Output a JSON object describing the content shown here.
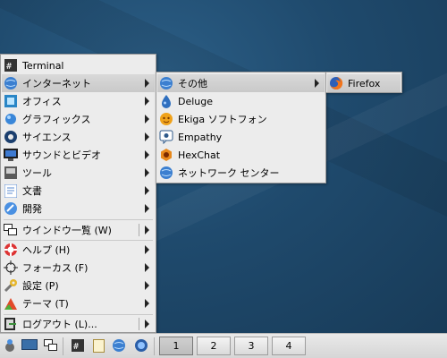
{
  "main_menu": {
    "items": [
      {
        "label": "Terminal"
      },
      {
        "label": "インターネット"
      },
      {
        "label": "オフィス"
      },
      {
        "label": "グラフィックス"
      },
      {
        "label": "サイエンス"
      },
      {
        "label": "サウンドとビデオ"
      },
      {
        "label": "ツール"
      },
      {
        "label": "文書"
      },
      {
        "label": "開発"
      },
      {
        "label": "ウインドウ一覧 (W)"
      },
      {
        "label": "ヘルプ (H)"
      },
      {
        "label": "フォーカス (F)"
      },
      {
        "label": "設定 (P)"
      },
      {
        "label": "テーマ (T)"
      },
      {
        "label": "ログアウト (L)..."
      }
    ]
  },
  "internet_menu": {
    "items": [
      {
        "label": "その他"
      },
      {
        "label": "Deluge"
      },
      {
        "label": "Ekiga ソフトフォン"
      },
      {
        "label": "Empathy"
      },
      {
        "label": "HexChat"
      },
      {
        "label": "ネットワーク センター"
      }
    ]
  },
  "other_menu": {
    "items": [
      {
        "label": "Firefox"
      }
    ]
  },
  "taskbar": {
    "workspaces": [
      "1",
      "2",
      "3",
      "4"
    ],
    "active_workspace": "1"
  }
}
